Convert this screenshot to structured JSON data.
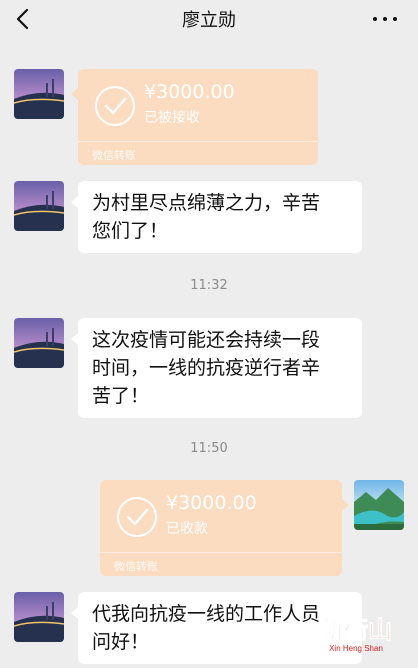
{
  "header": {
    "title": "廖立勋"
  },
  "icons": {
    "back": "chevron-left-icon",
    "more": "more-dots-icon",
    "check": "check-circle-icon"
  },
  "colors": {
    "background": "#ededed",
    "transfer_bg": "#fbdcc0",
    "bubble_bg": "#ffffff",
    "logo_red": "#e02020"
  },
  "messages": {
    "m1": {
      "amount": "¥3000.00",
      "status": "已被接收",
      "footer": "微信转账"
    },
    "m2": {
      "text_line1": "为村里尽点绵薄之力，辛苦",
      "text_line2": "您们了！"
    },
    "t1": "11:32",
    "m3": {
      "text_line1": "这次疫情可能还会持续一段",
      "text_line2": "时间，一线的抗疫逆行者辛",
      "text_line3": "苦了！"
    },
    "t2": "11:50",
    "m4": {
      "amount": "¥3000.00",
      "status": "已收款",
      "footer": "微信转账"
    },
    "m5": {
      "text_line1": "代我向抗疫一线的工作人员",
      "text_line2": "问好！"
    }
  },
  "watermark": {
    "main": "新衡山",
    "sub": "Xin Heng Shan"
  }
}
